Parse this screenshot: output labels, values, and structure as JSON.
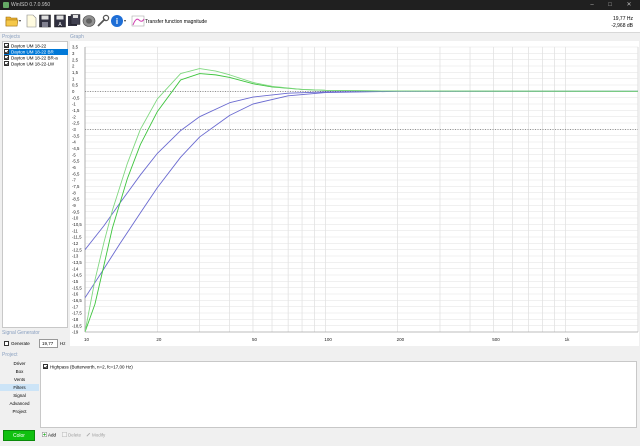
{
  "window": {
    "title": "WinISD 0.7.0.950"
  },
  "toolbar": {
    "view_label": "Transfer function magnitude",
    "freq_readout": "19,77 Hz",
    "level_readout": "-2,968 dB"
  },
  "sections": {
    "projects": "Projects",
    "graph": "Graph",
    "signal_generator": "Signal Generator",
    "project": "Project"
  },
  "projects": [
    {
      "label": "Dayton UM 18-22",
      "checked": true,
      "selected": false
    },
    {
      "label": "Dayton UM 18-22 BR",
      "checked": true,
      "selected": true
    },
    {
      "label": "Dayton UM 18-22 BR-a",
      "checked": true,
      "selected": false
    },
    {
      "label": "Dayton UM 18-22-LW",
      "checked": true,
      "selected": false
    }
  ],
  "signal_generator": {
    "generate_label": "Generate",
    "generate_checked": false,
    "frequency_value": "19,77",
    "frequency_unit": "Hz"
  },
  "project_nav": [
    {
      "label": "Driver",
      "active": false
    },
    {
      "label": "Box",
      "active": false
    },
    {
      "label": "Vents",
      "active": false
    },
    {
      "label": "Filters",
      "active": true
    },
    {
      "label": "Signal",
      "active": false
    },
    {
      "label": "Advanced",
      "active": false
    },
    {
      "label": "Project",
      "active": false
    }
  ],
  "filters": [
    {
      "label": "Highpass (Butterworth, n=2, fc=17,00 Hz)",
      "checked": true
    }
  ],
  "buttons": {
    "color": "Color",
    "add": "Add",
    "delete": "Delete",
    "modify": "Modify"
  },
  "colors": {
    "accent_green": "#10c010",
    "selection_blue": "#0078d7"
  },
  "chart_data": {
    "type": "line",
    "xscale": "log",
    "xlim": [
      10,
      2000
    ],
    "ylim": [
      -19,
      3.5
    ],
    "grid": true,
    "x_tick_labels": [
      {
        "value": 10,
        "label": "10"
      },
      {
        "value": 20,
        "label": "20"
      },
      {
        "value": 50,
        "label": "50"
      },
      {
        "value": 100,
        "label": "100"
      },
      {
        "value": 200,
        "label": "200"
      },
      {
        "value": 500,
        "label": "500"
      },
      {
        "value": 1000,
        "label": "1k"
      }
    ],
    "y_tick_labels": [
      "3,5",
      "3",
      "2,5",
      "2",
      "1,5",
      "1",
      "0,5",
      "0",
      "-0,5",
      "-1",
      "-1,5",
      "-2",
      "-2,5",
      "-3",
      "-3,5",
      "-4",
      "-4,5",
      "-5",
      "-5,5",
      "-6",
      "-6,5",
      "-7",
      "-7,5",
      "-8",
      "-8,5",
      "-9",
      "-9,5",
      "-10",
      "-10,5",
      "-11",
      "-11,5",
      "-12",
      "-12,5",
      "-13",
      "-13,5",
      "-14",
      "-14,5",
      "-15",
      "-15,5",
      "-16",
      "-16,5",
      "-17",
      "-17,5",
      "-18",
      "-18,5",
      "-19"
    ],
    "reference_lines": [
      0,
      -3
    ],
    "series": [
      {
        "color": "#6a6ad0",
        "x": [
          10,
          12,
          14,
          17,
          20,
          25,
          30,
          40,
          50,
          70,
          100,
          200,
          2000
        ],
        "y": [
          -12.5,
          -10.6,
          -8.8,
          -6.6,
          -4.9,
          -3.1,
          -2.0,
          -0.9,
          -0.45,
          -0.15,
          -0.05,
          0,
          0
        ]
      },
      {
        "color": "#6a6ad0",
        "x": [
          10,
          12,
          14,
          17,
          20,
          25,
          30,
          40,
          50,
          70,
          100,
          200,
          2000
        ],
        "y": [
          -16.3,
          -14.0,
          -12.0,
          -9.6,
          -7.6,
          -5.2,
          -3.6,
          -1.9,
          -1.0,
          -0.35,
          -0.1,
          0,
          0
        ]
      },
      {
        "color": "#3ec43e",
        "x": [
          10,
          11,
          12,
          13,
          15,
          17,
          20,
          25,
          30,
          35,
          40,
          50,
          60,
          80,
          100,
          200,
          2000
        ],
        "y": [
          -19,
          -16.8,
          -13.7,
          -10.8,
          -6.9,
          -4.2,
          -1.6,
          0.9,
          1.4,
          1.3,
          1.1,
          0.6,
          0.35,
          0.15,
          0.08,
          0.02,
          0
        ]
      },
      {
        "color": "#80d880",
        "x": [
          10,
          11,
          12,
          13,
          15,
          17,
          20,
          25,
          30,
          35,
          40,
          50,
          60,
          80,
          100,
          200,
          2000
        ],
        "y": [
          -19,
          -14.9,
          -11.9,
          -9.4,
          -5.7,
          -3.0,
          -0.6,
          1.4,
          1.8,
          1.6,
          1.3,
          0.7,
          0.4,
          0.15,
          0.08,
          0.02,
          0
        ]
      }
    ]
  }
}
